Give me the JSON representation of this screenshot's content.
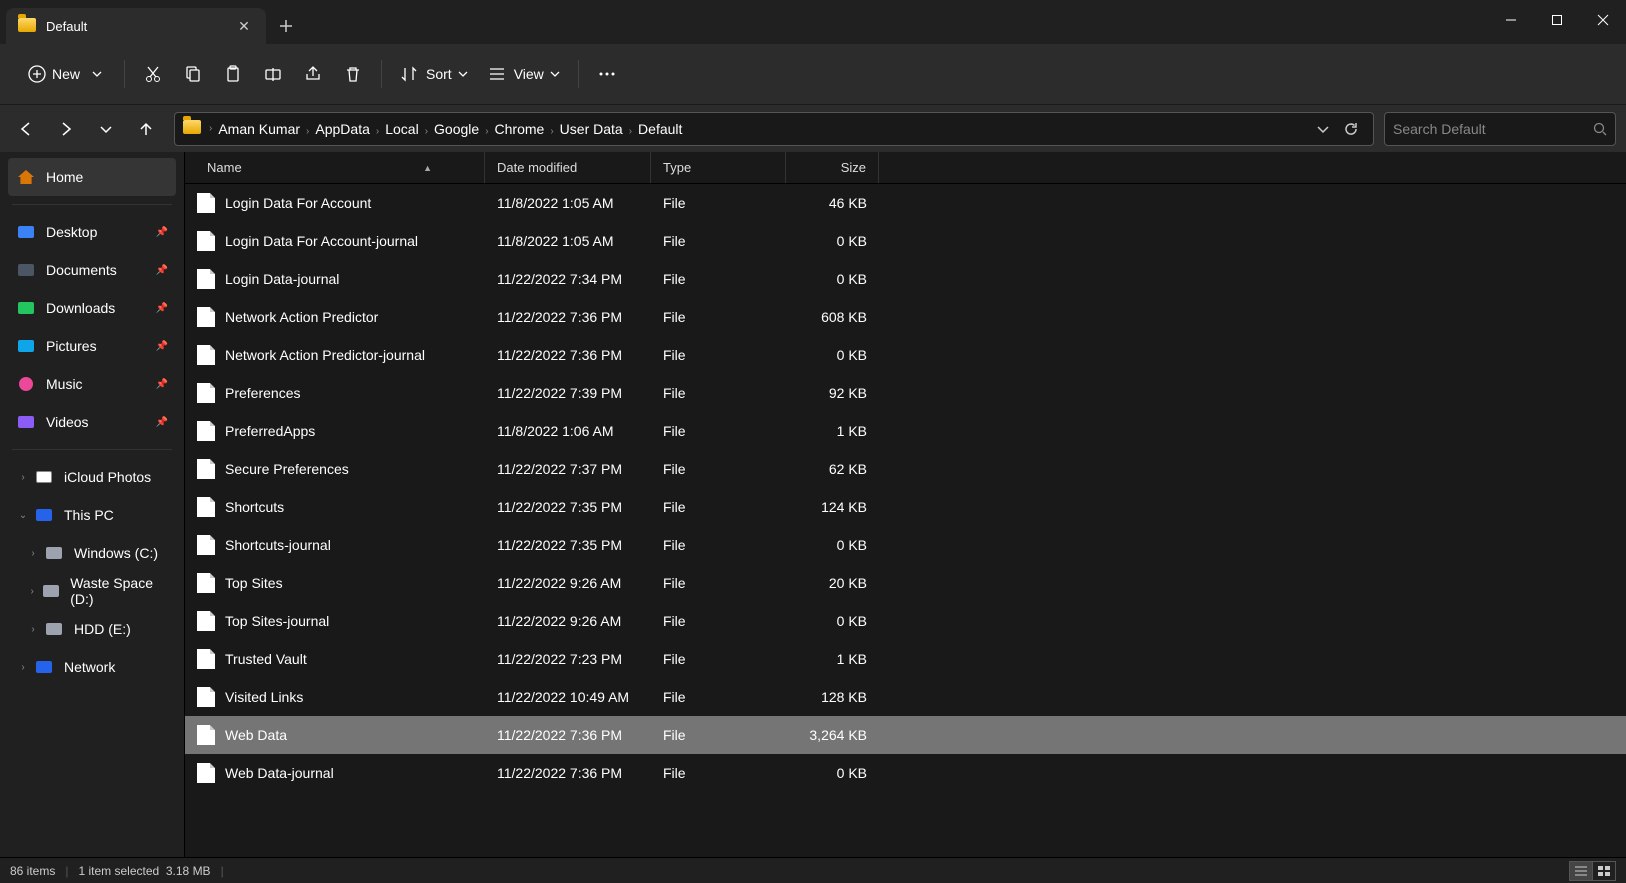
{
  "tab": {
    "title": "Default"
  },
  "toolbar": {
    "new_label": "New",
    "sort_label": "Sort",
    "view_label": "View"
  },
  "breadcrumbs": [
    "Aman Kumar",
    "AppData",
    "Local",
    "Google",
    "Chrome",
    "User Data",
    "Default"
  ],
  "search": {
    "placeholder": "Search Default"
  },
  "sidebar": {
    "home": "Home",
    "quick": [
      {
        "label": "Desktop",
        "pinned": true,
        "icon": "blue"
      },
      {
        "label": "Documents",
        "pinned": true,
        "icon": "doc"
      },
      {
        "label": "Downloads",
        "pinned": true,
        "icon": "green"
      },
      {
        "label": "Pictures",
        "pinned": true,
        "icon": "pic"
      },
      {
        "label": "Music",
        "pinned": true,
        "icon": "music"
      },
      {
        "label": "Videos",
        "pinned": true,
        "icon": "vid"
      }
    ],
    "groups": [
      {
        "label": "iCloud Photos",
        "icon": "cloud",
        "expandable": true
      },
      {
        "label": "This PC",
        "icon": "pc",
        "expandable": true,
        "expanded": true
      }
    ],
    "drives": [
      {
        "label": "Windows (C:)"
      },
      {
        "label": "Waste Space (D:)"
      },
      {
        "label": "HDD (E:)"
      }
    ],
    "network": {
      "label": "Network"
    }
  },
  "columns": {
    "name": "Name",
    "date": "Date modified",
    "type": "Type",
    "size": "Size"
  },
  "files": [
    {
      "name": "Login Data For Account",
      "date": "11/8/2022 1:05 AM",
      "type": "File",
      "size": "46 KB"
    },
    {
      "name": "Login Data For Account-journal",
      "date": "11/8/2022 1:05 AM",
      "type": "File",
      "size": "0 KB"
    },
    {
      "name": "Login Data-journal",
      "date": "11/22/2022 7:34 PM",
      "type": "File",
      "size": "0 KB"
    },
    {
      "name": "Network Action Predictor",
      "date": "11/22/2022 7:36 PM",
      "type": "File",
      "size": "608 KB"
    },
    {
      "name": "Network Action Predictor-journal",
      "date": "11/22/2022 7:36 PM",
      "type": "File",
      "size": "0 KB"
    },
    {
      "name": "Preferences",
      "date": "11/22/2022 7:39 PM",
      "type": "File",
      "size": "92 KB"
    },
    {
      "name": "PreferredApps",
      "date": "11/8/2022 1:06 AM",
      "type": "File",
      "size": "1 KB"
    },
    {
      "name": "Secure Preferences",
      "date": "11/22/2022 7:37 PM",
      "type": "File",
      "size": "62 KB"
    },
    {
      "name": "Shortcuts",
      "date": "11/22/2022 7:35 PM",
      "type": "File",
      "size": "124 KB"
    },
    {
      "name": "Shortcuts-journal",
      "date": "11/22/2022 7:35 PM",
      "type": "File",
      "size": "0 KB"
    },
    {
      "name": "Top Sites",
      "date": "11/22/2022 9:26 AM",
      "type": "File",
      "size": "20 KB"
    },
    {
      "name": "Top Sites-journal",
      "date": "11/22/2022 9:26 AM",
      "type": "File",
      "size": "0 KB"
    },
    {
      "name": "Trusted Vault",
      "date": "11/22/2022 7:23 PM",
      "type": "File",
      "size": "1 KB"
    },
    {
      "name": "Visited Links",
      "date": "11/22/2022 10:49 AM",
      "type": "File",
      "size": "128 KB"
    },
    {
      "name": "Web Data",
      "date": "11/22/2022 7:36 PM",
      "type": "File",
      "size": "3,264 KB",
      "selected": true
    },
    {
      "name": "Web Data-journal",
      "date": "11/22/2022 7:36 PM",
      "type": "File",
      "size": "0 KB"
    }
  ],
  "status": {
    "count": "86 items",
    "selection": "1 item selected",
    "size": "3.18 MB"
  }
}
